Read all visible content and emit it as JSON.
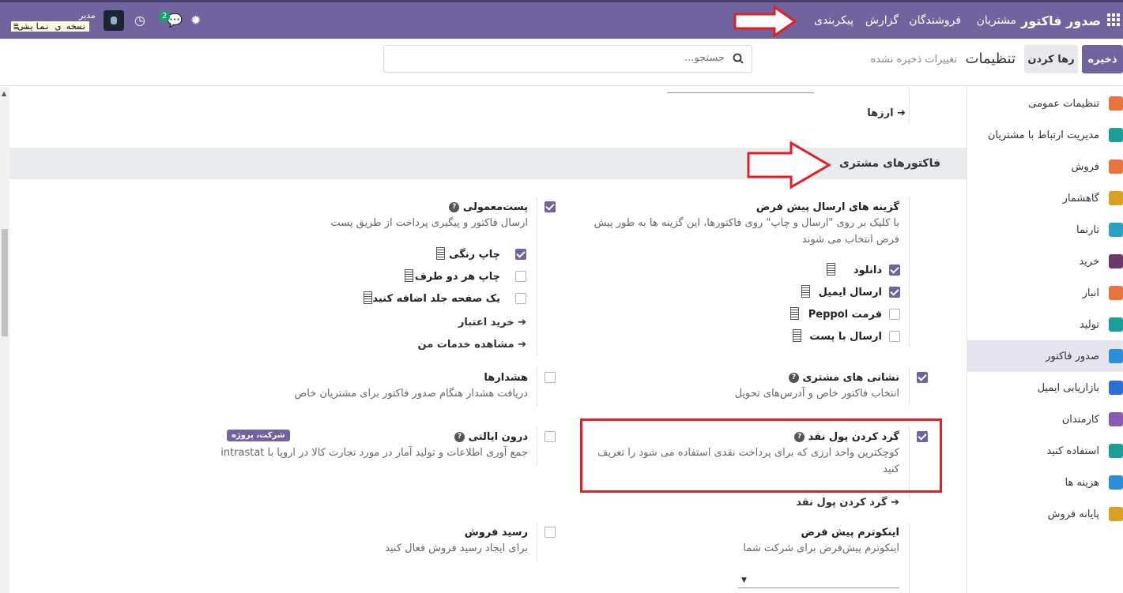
{
  "navbar": {
    "brand": "صدور فاکتور",
    "menu": [
      "مشتریان",
      "فروشندگان",
      "گزارش",
      "پیکربندی"
    ],
    "badge_count": "2",
    "user": "مدیر",
    "demo_label": "نسخه ی نمایشی"
  },
  "control": {
    "save": "ذخیره",
    "discard": "رها کردن",
    "title": "تنظیمات",
    "unsaved": "تغییرات ذخیره نشده",
    "search_placeholder": "جستجو..."
  },
  "sidebar": {
    "items": [
      {
        "label": "تنظیمات عمومی",
        "color": "#e8743b"
      },
      {
        "label": "مدیریت ارتباط با مشتریان",
        "color": "#1aa09a"
      },
      {
        "label": "فروش",
        "color": "#e8743b"
      },
      {
        "label": "گاهشمار",
        "color": "#d9a021"
      },
      {
        "label": "تارنما",
        "color": "#2aa0c8"
      },
      {
        "label": "خرید",
        "color": "#6b3a6b"
      },
      {
        "label": "انبار",
        "color": "#e8743b"
      },
      {
        "label": "تولید",
        "color": "#1aa09a"
      },
      {
        "label": "صدور فاکتور",
        "color": "#2a8fd8"
      },
      {
        "label": "بازاریابی ایمیل",
        "color": "#2a6fd8"
      },
      {
        "label": "کارمندان",
        "color": "#8a5ab0"
      },
      {
        "label": "استفاده کنید",
        "color": "#1aa09a"
      },
      {
        "label": "هزینه ها",
        "color": "#2a8fd8"
      },
      {
        "label": "پایانه فروش",
        "color": "#d9a021"
      }
    ]
  },
  "content": {
    "currencies_link": "ارزها",
    "section_title": "فاکتورهای مشتری",
    "send_options": {
      "title": "گزینه های ارسال پیش فرض",
      "desc": "با کلیک بر روی \"ارسال و چاپ\" روی فاکتورها، این گزینه ها به طور پیش فرض انتخاب می شوند",
      "options": [
        {
          "label": "دانلود",
          "checked": true
        },
        {
          "label": "ارسال ایمیل",
          "checked": true
        },
        {
          "label": "فرمت Peppol",
          "checked": false
        },
        {
          "label": "ارسال با پست",
          "checked": false
        }
      ]
    },
    "postal": {
      "title": "پست‌معمولی",
      "desc": "ارسال فاکتور و پیگیری پرداخت از طریق پست",
      "options": [
        {
          "label": "چاپ رنگی",
          "checked": true
        },
        {
          "label": "چاپ هر دو طرف",
          "checked": false
        },
        {
          "label": "یک صفحه جلد اضافه کنید",
          "checked": false
        }
      ],
      "link_buy": "خرید اعتبار",
      "link_services": "مشاهده خدمات من"
    },
    "customer_addresses": {
      "title": "نشانی های مشتری",
      "desc": "انتخاب فاکتور خاص و آدرس‌های تحویل"
    },
    "warnings": {
      "title": "هشدارها",
      "desc": "دریافت هشدار هنگام صدور فاکتور برای مشتریان خاص"
    },
    "cash_rounding": {
      "title": "گرد کردن پول نقد",
      "desc": "کوچکترین واحد ارزی که برای پرداخت نقدی استفاده می شود را تعریف کنید",
      "link": "گرد کردن پول نقد"
    },
    "intrastat": {
      "title": "درون ایالتی",
      "tag": "شرکت، پروژه",
      "desc": "جمع آوری اطلاعات و تولید آمار در مورد تجارت کالا در اروپا با intrastat"
    },
    "incoterm": {
      "title": "اینکوترم پیش فرض",
      "desc": "اینکوترم پیش‌فرض برای شرکت شما"
    },
    "sales_receipt": {
      "title": "رسید فروش",
      "desc": "برای ایجاد رسید فروش فعال کنید"
    }
  }
}
